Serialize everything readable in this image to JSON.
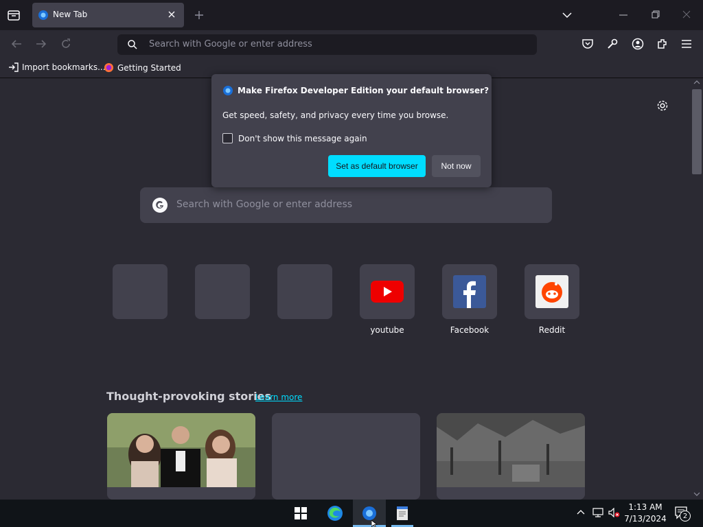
{
  "tab": {
    "title": "New Tab"
  },
  "urlbar": {
    "placeholder": "Search with Google or enter address"
  },
  "bookmarks": [
    {
      "label": "Import bookmarks..."
    },
    {
      "label": "Getting Started"
    }
  ],
  "popup": {
    "title": "Make Firefox Developer Edition your default browser?",
    "body": "Get speed, safety, and privacy every time you browse.",
    "checkbox_label": "Don't show this message again",
    "primary_button": "Set as default browser",
    "secondary_button": "Not now"
  },
  "search": {
    "placeholder": "Search with Google or enter address"
  },
  "top_sites": [
    {
      "label": ""
    },
    {
      "label": ""
    },
    {
      "label": ""
    },
    {
      "label": "youtube",
      "icon": "youtube-icon"
    },
    {
      "label": "Facebook",
      "icon": "facebook-icon"
    },
    {
      "label": "Reddit",
      "icon": "reddit-icon"
    }
  ],
  "stories": {
    "title": "Thought-provoking stories",
    "link": "Learn more"
  },
  "taskbar": {
    "time": "1:13 AM",
    "date": "7/13/2024",
    "notification_count": "2"
  },
  "colors": {
    "accent": "#00ddff",
    "background": "#2b2a33",
    "toolbar": "#1c1b22"
  }
}
